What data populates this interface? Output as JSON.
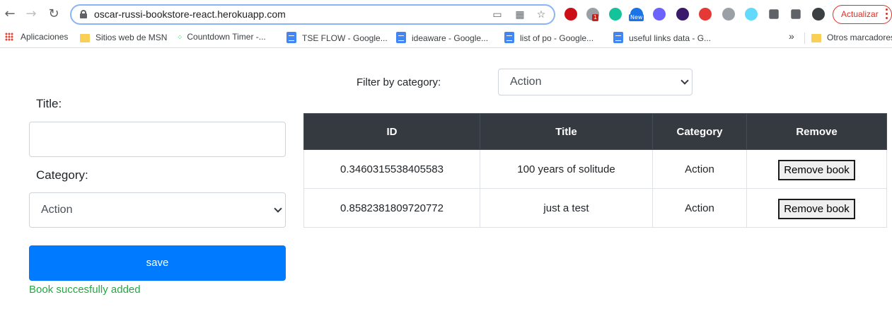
{
  "browser": {
    "url": "oscar-russi-bookstore-react.herokuapp.com",
    "update_label": "Actualizar",
    "bookmarks": [
      {
        "label": "Aplicaciones",
        "icon": "apps-grid-icon"
      },
      {
        "label": "Sitios web de MSN",
        "icon": "folder-icon"
      },
      {
        "label": "Countdown Timer -...",
        "icon": "timer-icon"
      },
      {
        "label": "TSE FLOW - Google...",
        "icon": "google-docs-icon"
      },
      {
        "label": "ideaware - Google...",
        "icon": "google-docs-icon"
      },
      {
        "label": "list of po - Google...",
        "icon": "google-docs-icon"
      },
      {
        "label": "useful links data - G...",
        "icon": "google-docs-icon"
      }
    ],
    "more_bookmarks": "»",
    "other_bookmarks": "Otros marcadores",
    "extensions": [
      {
        "name": "opera-icon",
        "color": "#cc0f16"
      },
      {
        "name": "badge-extension-icon",
        "color": "#9aa0a6",
        "badge": "1"
      },
      {
        "name": "grammarly-icon",
        "color": "#15c39a"
      },
      {
        "name": "new-extension-icon",
        "color": "#1a73e8",
        "badge": "New"
      },
      {
        "name": "flower-extension-icon",
        "color": "#6c63ff"
      },
      {
        "name": "dashboard-extension-icon",
        "color": "#3a1a6b"
      },
      {
        "name": "video-extension-icon",
        "color": "#e53935"
      },
      {
        "name": "gray-extension-icon",
        "color": "#9aa0a6"
      },
      {
        "name": "react-devtools-icon",
        "color": "#61dafb"
      },
      {
        "name": "puzzle-icon",
        "color": "#5f6368"
      },
      {
        "name": "media-queue-icon",
        "color": "#5f6368"
      },
      {
        "name": "profile-avatar-icon",
        "color": "#3c4043"
      }
    ]
  },
  "form": {
    "title_label": "Title:",
    "title_value": "",
    "category_label": "Category:",
    "category_value": "Action",
    "save_label": "save",
    "success_message": "Book succesfully added"
  },
  "filter": {
    "label": "Filter by category:",
    "value": "Action"
  },
  "table": {
    "headers": [
      "ID",
      "Title",
      "Category",
      "Remove"
    ],
    "rows": [
      {
        "id": "0.3460315538405583",
        "title": "100 years of solitude",
        "category": "Action",
        "remove_label": "Remove book"
      },
      {
        "id": "0.8582381809720772",
        "title": "just a test",
        "category": "Action",
        "remove_label": "Remove book"
      }
    ]
  }
}
